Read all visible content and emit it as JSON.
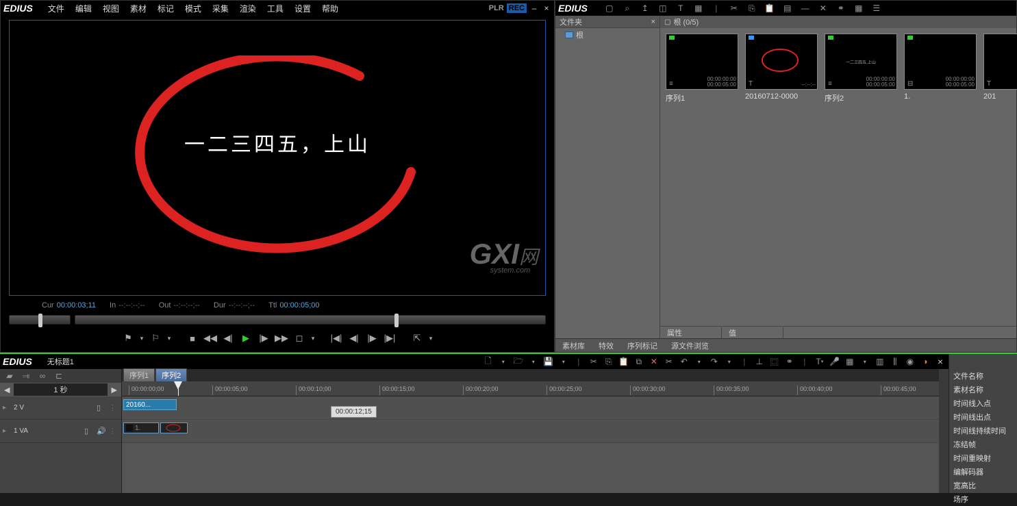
{
  "menubar": {
    "app": "EDIUS",
    "items": [
      "文件",
      "编辑",
      "视图",
      "素材",
      "标记",
      "模式",
      "采集",
      "渲染",
      "工具",
      "设置",
      "帮助"
    ],
    "plr": "PLR",
    "rec": "REC"
  },
  "preview": {
    "text": "一二三四五，上山",
    "watermark_big": "GXI",
    "watermark_small": "网",
    "watermark_sub": "system.com",
    "tc": {
      "cur_label": "Cur",
      "cur_val": "00:00:03;11",
      "in_label": "In",
      "in_val": "--:--:--;--",
      "out_label": "Out",
      "out_val": "--:--:--;--",
      "dur_label": "Dur",
      "dur_val": "--:--:--;--",
      "ttl_label": "Ttl",
      "ttl_val": "00:00:05;00"
    }
  },
  "bin": {
    "app": "EDIUS",
    "folder_header": "文件夹",
    "root_name": "根",
    "clip_header": "根 (0/5)",
    "clips": [
      {
        "name": "序列1",
        "tc1": "00:00:00:00",
        "tc2": "00:00:05:00",
        "badge": "#3c3",
        "type": "≡"
      },
      {
        "name": "20160712-0000",
        "tc1": "",
        "tc2": "--:--:--",
        "badge": "#39f",
        "type": "T",
        "has_ellipse": true
      },
      {
        "name": "序列2",
        "tc1": "00:00:00:00",
        "tc2": "00:00:05:00",
        "badge": "#3c3",
        "type": "≡",
        "mini_text": "一二三四五,上山"
      },
      {
        "name": "1.",
        "tc1": "00:00:00:00",
        "tc2": "00:00:05:00",
        "badge": "#3c3",
        "type": "⊟"
      },
      {
        "name": "201",
        "tc1": "",
        "tc2": "",
        "badge": "",
        "type": "T"
      }
    ],
    "prop_attr": "属性",
    "prop_val": "值",
    "tabs": [
      "素材库",
      "特效",
      "序列标记",
      "源文件浏览"
    ]
  },
  "timeline": {
    "project": "无标题1",
    "seq_tabs": [
      "序列1",
      "序列2"
    ],
    "active_seq": 1,
    "zoom": "1 秒",
    "ruler": [
      "00:00:00;00",
      "00:00:05;00",
      "00:00:10;00",
      "00:00:15;00",
      "00:00:20;00",
      "00:00:25;00",
      "00:00:30;00",
      "00:00:35;00",
      "00:00:40;00",
      "00:00:45;00"
    ],
    "tooltip": "00:00:12;15",
    "tracks": [
      {
        "name": "2 V",
        "clips": [
          {
            "label": "20160...",
            "x": 2,
            "w": 78,
            "sel": true
          }
        ]
      },
      {
        "name": "1 VA",
        "clips": [
          {
            "label": "1.",
            "x": 2,
            "w": 52,
            "dark": true
          },
          {
            "label": "",
            "x": 56,
            "w": 40,
            "dark": true,
            "ellipse": true
          }
        ]
      }
    ]
  },
  "info": {
    "rows": [
      "文件名称",
      "素材名称",
      "时间线入点",
      "时间线出点",
      "时间线持续时间",
      "冻结帧",
      "时间重映射",
      "编解码器",
      "宽高比",
      "场序"
    ]
  },
  "icons": {
    "min": "–",
    "close": "×",
    "search": "🔍",
    "undo": "↶",
    "redo": "↷",
    "play": "▶",
    "stop": "■",
    "rew": "◀◀",
    "prev": "◀|",
    "next": "|▶",
    "ff": "▶▶",
    "in": "⌈",
    "out": "⌉",
    "loop": "↻",
    "arrow_l": "◀",
    "arrow_r": "▶",
    "speaker": "🔊",
    "expand": "▸"
  }
}
